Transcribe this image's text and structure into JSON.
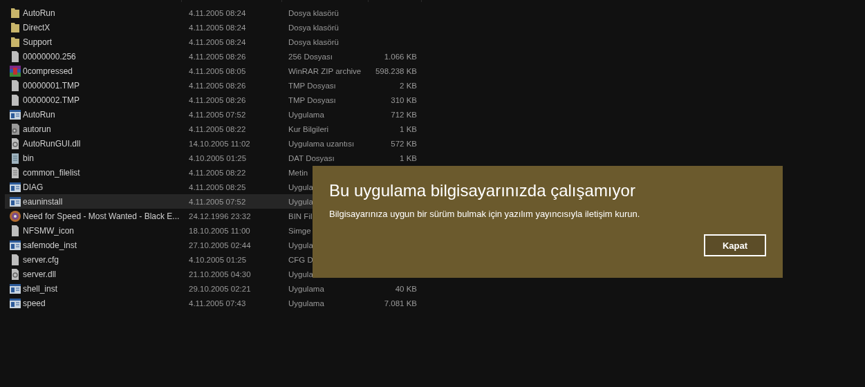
{
  "files": [
    {
      "kind": "folder",
      "name": "AutoRun",
      "date": "4.11.2005 08:24",
      "type": "Dosya klasörü",
      "selected": false
    },
    {
      "kind": "folder",
      "name": "DirectX",
      "date": "4.11.2005 08:24",
      "type": "Dosya klasörü",
      "selected": false
    },
    {
      "kind": "folder",
      "name": "Support",
      "date": "4.11.2005 08:24",
      "type": "Dosya klasörü",
      "selected": false
    },
    {
      "kind": "file",
      "name": "00000000.256",
      "date": "4.11.2005 08:26",
      "type": "256 Dosyası",
      "size": "1.066 KB",
      "selected": false
    },
    {
      "kind": "archive",
      "name": "0compressed",
      "date": "4.11.2005 08:05",
      "type": "WinRAR ZIP archive",
      "size": "598.238 KB",
      "selected": false
    },
    {
      "kind": "file",
      "name": "00000001.TMP",
      "date": "4.11.2005 08:26",
      "type": "TMP Dosyası",
      "size": "2 KB",
      "selected": false
    },
    {
      "kind": "file",
      "name": "00000002.TMP",
      "date": "4.11.2005 08:26",
      "type": "TMP Dosyası",
      "size": "310 KB",
      "selected": false
    },
    {
      "kind": "app",
      "name": "AutoRun",
      "date": "4.11.2005 07:52",
      "type": "Uygulama",
      "size": "712 KB",
      "selected": false
    },
    {
      "kind": "settings",
      "name": "autorun",
      "date": "4.11.2005 08:22",
      "type": "Kur Bilgileri",
      "size": "1 KB",
      "selected": false
    },
    {
      "kind": "dll",
      "name": "AutoRunGUI.dll",
      "date": "14.10.2005 11:02",
      "type": "Uygulama uzantısı",
      "size": "572 KB",
      "selected": false
    },
    {
      "kind": "notepad",
      "name": "bin",
      "date": "4.10.2005 01:25",
      "type": "DAT Dosyası",
      "size": "1 KB",
      "selected": false
    },
    {
      "kind": "text",
      "name": "common_filelist",
      "date": "4.11.2005 08:22",
      "type": "Metin",
      "selected": false
    },
    {
      "kind": "app",
      "name": "DIAG",
      "date": "4.11.2005 08:25",
      "type": "Uygula",
      "selected": false
    },
    {
      "kind": "app",
      "name": "eauninstall",
      "date": "4.11.2005 07:52",
      "type": "Uygula",
      "selected": true
    },
    {
      "kind": "disc",
      "name": "Need for Speed - Most Wanted - Black E...",
      "date": "24.12.1996 23:32",
      "type": "BIN Fil",
      "selected": false
    },
    {
      "kind": "file",
      "name": "NFSMW_icon",
      "date": "18.10.2005 11:00",
      "type": "Simge",
      "selected": false
    },
    {
      "kind": "app",
      "name": "safemode_inst",
      "date": "27.10.2005 02:44",
      "type": "Uygula",
      "selected": false
    },
    {
      "kind": "file",
      "name": "server.cfg",
      "date": "4.10.2005 01:25",
      "type": "CFG D",
      "selected": false
    },
    {
      "kind": "dll",
      "name": "server.dll",
      "date": "21.10.2005 04:30",
      "type": "Uygula",
      "selected": false
    },
    {
      "kind": "app",
      "name": "shell_inst",
      "date": "29.10.2005 02:21",
      "type": "Uygulama",
      "size": "40 KB",
      "selected": false
    },
    {
      "kind": "app",
      "name": "speed",
      "date": "4.11.2005 07:43",
      "type": "Uygulama",
      "size": "7.081 KB",
      "selected": false
    }
  ],
  "dialog": {
    "title": "Bu uygulama bilgisayarınızda çalışamıyor",
    "message": "Bilgisayarınıza uygun bir sürüm bulmak için yazılım yayıncısıyla iletişim kurun.",
    "button": "Kapat"
  }
}
